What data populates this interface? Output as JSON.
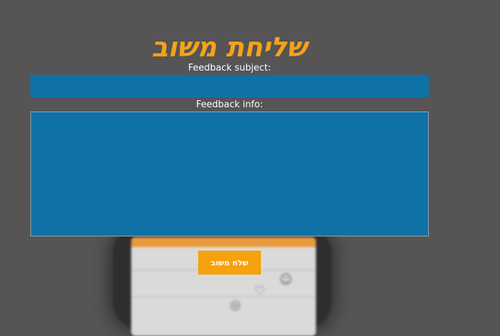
{
  "page": {
    "title": "שליחת משוב"
  },
  "form": {
    "subject_label": "Feedback subject:",
    "subject_value": "",
    "info_label": "Feedback info:",
    "info_value": "",
    "submit_label": "שלח משוב"
  },
  "colors": {
    "background": "#565455",
    "title": "#f5a31a",
    "field": "#0e72a7",
    "button": "#f5a20e",
    "label_text": "#ffffff"
  },
  "background_decor": {
    "icons": [
      "heart-icon",
      "user-icon",
      "location-icon"
    ]
  }
}
